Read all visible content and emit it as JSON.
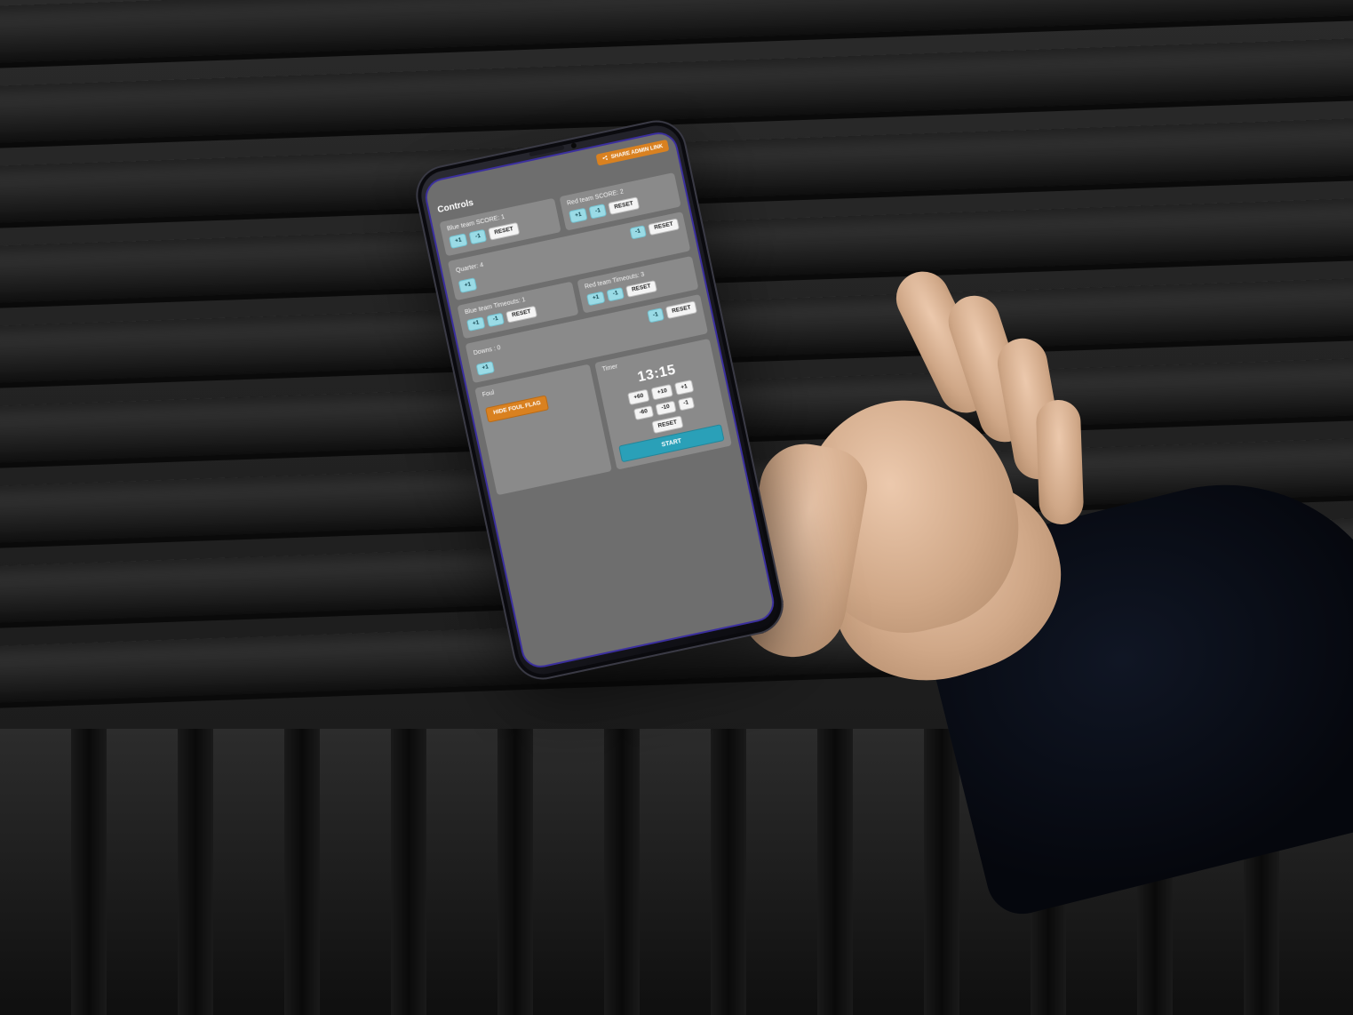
{
  "header": {
    "share_label": "SHARE ADMIN LINK",
    "controls_title": "Controls"
  },
  "score_blue": {
    "label": "Blue team SCORE: 1",
    "plus": "+1",
    "minus": "-1",
    "reset": "RESET"
  },
  "score_red": {
    "label": "Red team SCORE: 2",
    "plus": "+1",
    "minus": "-1",
    "reset": "RESET"
  },
  "quarter": {
    "label": "Quarter: 4",
    "plus": "+1",
    "minus": "-1",
    "reset": "RESET"
  },
  "to_blue": {
    "label": "Blue team Timeouts: 1",
    "plus": "+1",
    "minus": "-1",
    "reset": "RESET"
  },
  "to_red": {
    "label": "Red team Timeouts: 3",
    "plus": "+1",
    "minus": "-1",
    "reset": "RESET"
  },
  "downs": {
    "label": "Downs : 0",
    "plus": "+1",
    "minus": "-1",
    "reset": "RESET"
  },
  "foul": {
    "label": "Foul",
    "button": "HIDE FOUL FLAG"
  },
  "timer": {
    "label": "Timer",
    "value": "13:15",
    "p60": "+60",
    "p10": "+10",
    "p1": "+1",
    "m60": "-60",
    "m10": "-10",
    "m1": "-1",
    "reset": "RESET",
    "start": "START"
  }
}
